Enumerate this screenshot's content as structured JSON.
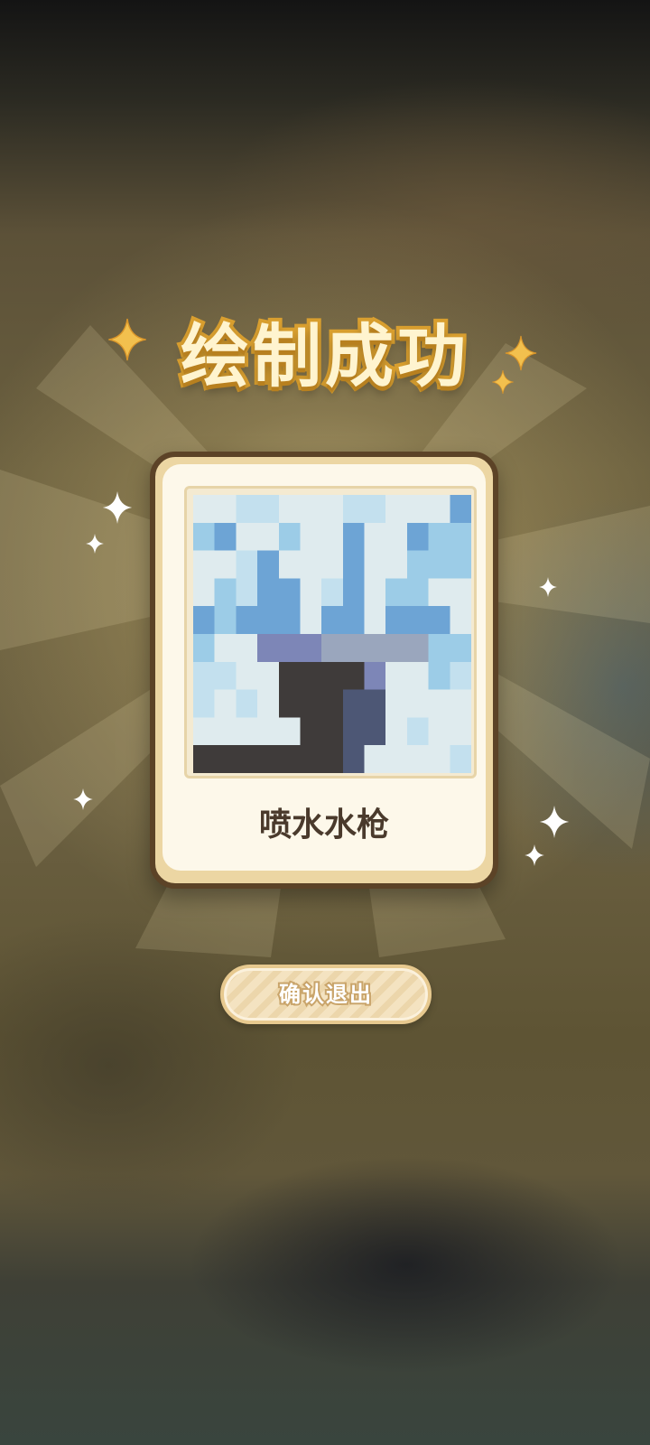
{
  "popup": {
    "title": "绘制成功",
    "item_name": "喷水水枪",
    "confirm_label": "确认退出"
  },
  "pixel_art": {
    "palette": {
      "1": "#dfebee",
      "2": "#c3e0ee",
      "3": "#9ccce7",
      "4": "#6da4d5",
      "5": "#7d86b7",
      "6": "#9aa6bd",
      "7": "#3f3b3a",
      "8": "#4d5775"
    },
    "rows": [
      "1122111221114",
      "3411311411433",
      "1124111411333",
      "1324412413311",
      "4344414414441",
      "3115556666633",
      "2211777751132",
      "2121777881111",
      "1111177881211",
      "7777777811112"
    ]
  },
  "colors": {
    "title_fill": "#fff4cf",
    "title_stroke": "#d99f2f",
    "card_border": "#5c4327",
    "card_bg": "#fdf8ea",
    "sparkle_gold": "#f2c04e",
    "sparkle_white": "#ffffff"
  },
  "icons": {
    "sparkle_gold": "four-point-star-gold",
    "sparkle_white": "four-point-star-white"
  }
}
